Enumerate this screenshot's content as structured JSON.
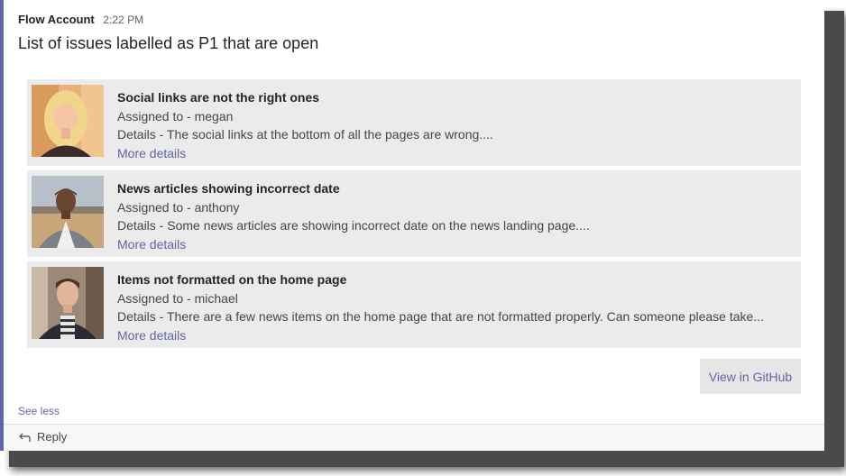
{
  "message": {
    "sender": "Flow Account",
    "time": "2:22 PM",
    "title": "List of issues labelled as P1 that are open"
  },
  "issues": [
    {
      "title": "Social links are not the right ones",
      "assigned": "Assigned to - megan",
      "details": "Details - The social links at the bottom of all the pages are wrong....",
      "more_label": "More details",
      "avatar": "woman-portrait"
    },
    {
      "title": "News articles showing incorrect date",
      "assigned": "Assigned to - anthony",
      "details": "Details - Some news articles are showing incorrect date on the news landing page....",
      "more_label": "More details",
      "avatar": "man-portrait-outdoor"
    },
    {
      "title": "Items not formatted on the home page",
      "assigned": "Assigned to - michael",
      "details": "Details - There are a few news items on the home page that are not formatted properly. Can someone please take...",
      "more_label": "More details",
      "avatar": "man-portrait-indoor"
    }
  ],
  "actions": {
    "view_github": "View in GitHub",
    "see_less": "See less",
    "reply": "Reply",
    "reply_icon": "reply-arrow-icon"
  },
  "colors": {
    "accent": "#6264a7",
    "item_bg": "#ebebeb"
  }
}
